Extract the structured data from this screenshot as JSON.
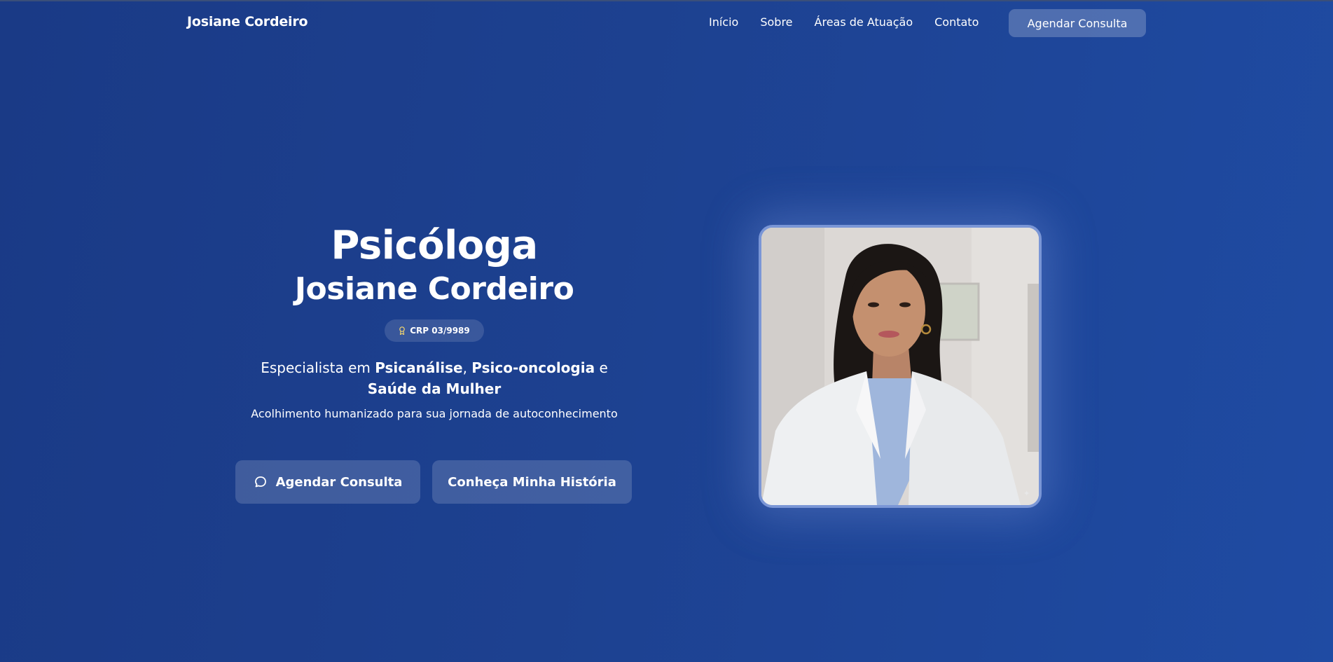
{
  "nav": {
    "brand": "Josiane Cordeiro",
    "links": [
      "Início",
      "Sobre",
      "Áreas de Atuação",
      "Contato"
    ],
    "cta": "Agendar Consulta"
  },
  "hero": {
    "title": "Psicóloga",
    "name": "Josiane Cordeiro",
    "badge": "CRP 03/9989",
    "specialty": {
      "prefix": "Especialista em ",
      "item1": "Psicanálise",
      "sep1": ", ",
      "item2": "Psico-oncologia",
      "sep2": " e ",
      "item3": "Saúde da Mulher"
    },
    "tagline": "Acolhimento humanizado para sua jornada de autoconhecimento",
    "primary_button": "Agendar Consulta",
    "secondary_button": "Conheça Minha História"
  },
  "colors": {
    "background_start": "#1a3a86",
    "background_end": "#1f4ba3",
    "portrait_border": "#7a96d6",
    "badge_icon": "#f5d76e"
  },
  "icons": {
    "badge": "award-icon",
    "primary_button": "chat-bubble-icon"
  }
}
